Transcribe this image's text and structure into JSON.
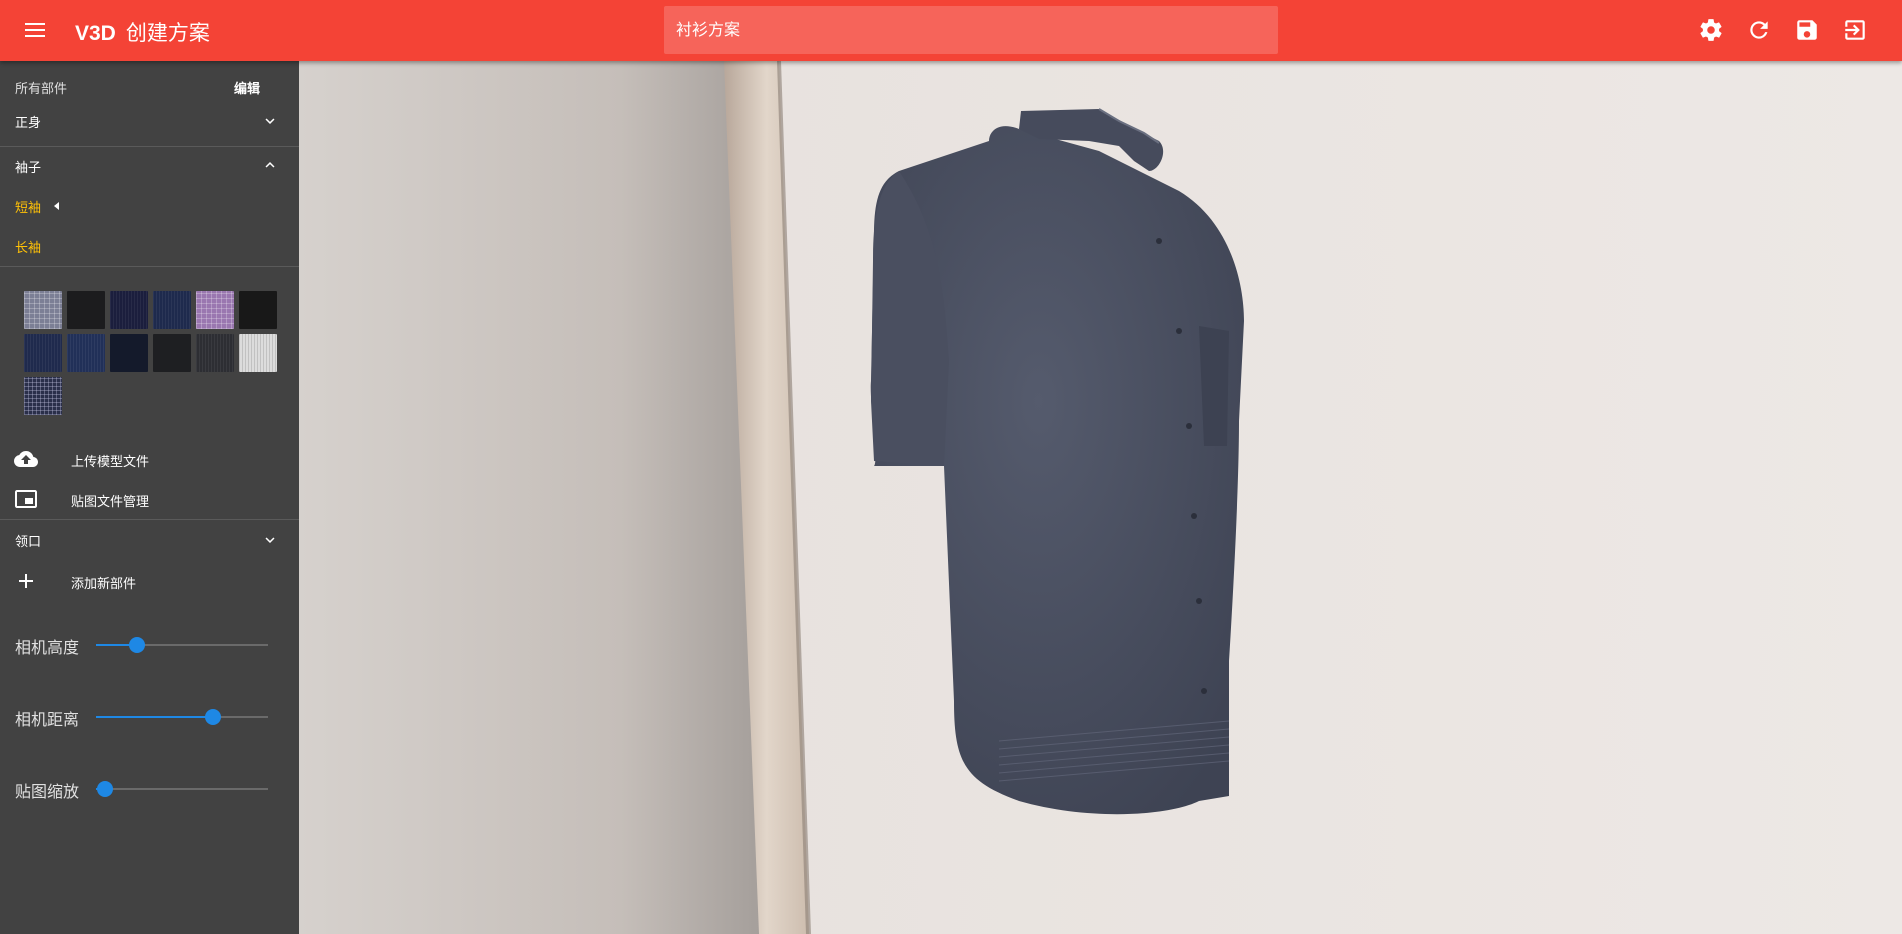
{
  "header": {
    "brand": "V3D",
    "title": "创建方案",
    "search_value": "衬衫方案",
    "icons": [
      "menu-icon",
      "settings-icon",
      "refresh-icon",
      "save-icon",
      "exit-icon"
    ]
  },
  "sidebar": {
    "all_parts_label": "所有部件",
    "edit_label": "编辑",
    "sections": [
      {
        "label": "正身",
        "expanded": false
      },
      {
        "label": "袖子",
        "expanded": true
      },
      {
        "label": "领口",
        "expanded": false
      }
    ],
    "sleeve_options": [
      {
        "label": "短袖",
        "selected": true
      },
      {
        "label": "长袖",
        "selected": false
      }
    ],
    "upload_label": "上传模型文件",
    "texture_manage_label": "贴图文件管理",
    "add_part_label": "添加新部件",
    "highlight_color": "#ffc107"
  },
  "sliders": [
    {
      "label": "相机高度",
      "value": 0.24
    },
    {
      "label": "相机距离",
      "value": 0.68
    },
    {
      "label": "贴图缩放",
      "value": 0.05
    }
  ],
  "colors": {
    "topbar": "#f44336",
    "sidebar": "#424242",
    "accent": "#1e88e5",
    "shirt": "#4a5061"
  },
  "swatches": [
    {
      "color": "#7c7f95",
      "pattern": "plaid-light"
    },
    {
      "color": "#1c1c1e",
      "pattern": "solid"
    },
    {
      "color": "#1b1e3d",
      "pattern": "fine"
    },
    {
      "color": "#1e2a4d",
      "pattern": "fine"
    },
    {
      "color": "#9a77b0",
      "pattern": "plaid-purple"
    },
    {
      "color": "#181818",
      "pattern": "solid"
    },
    {
      "color": "#1f2a4d",
      "pattern": "fine"
    },
    {
      "color": "#213058",
      "pattern": "fine"
    },
    {
      "color": "#141a2b",
      "pattern": "solid"
    },
    {
      "color": "#1e1f22",
      "pattern": "solid"
    },
    {
      "color": "#2d2e33",
      "pattern": "fine"
    },
    {
      "color": "#dcdcdc",
      "pattern": "stripe-white"
    },
    {
      "color": "#2a2f4a",
      "pattern": "grid"
    }
  ]
}
